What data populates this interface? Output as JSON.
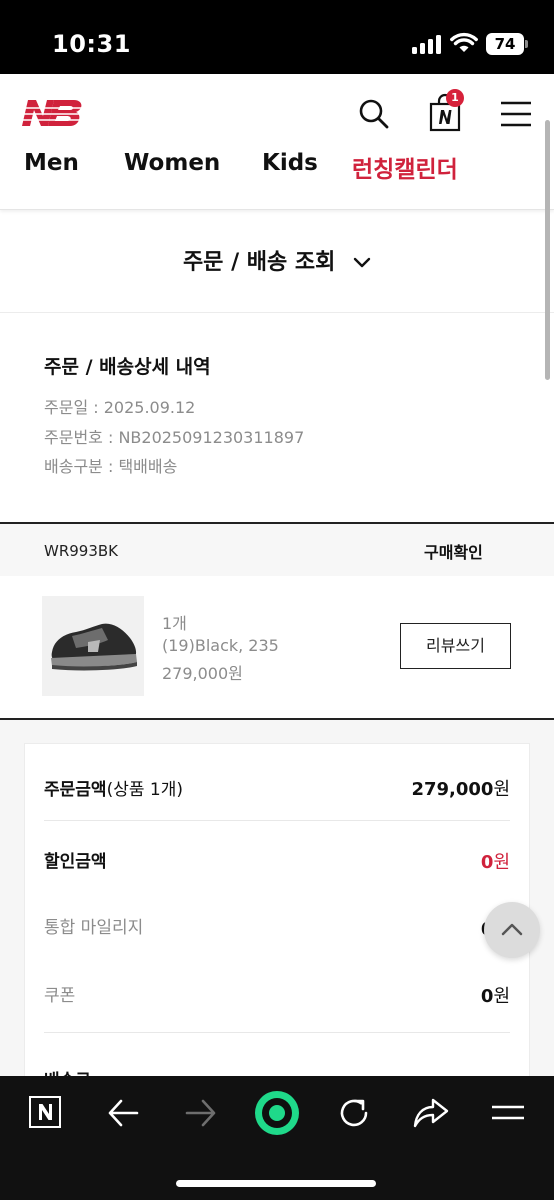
{
  "status": {
    "time": "10:31",
    "battery": "74"
  },
  "header": {
    "cart_count": "1",
    "nav": [
      "Men",
      "Women",
      "Kids",
      "런칭캘린더"
    ]
  },
  "page": {
    "title": "주문 / 배송 조회"
  },
  "detail": {
    "title": "주문 / 배송상세 내역",
    "order_date": "주문일 : 2025.09.12",
    "order_number": "주문번호 : NB2025091230311897",
    "delivery_type": "배송구분 : 택배배송"
  },
  "item": {
    "code": "WR993BK",
    "status": "구매확인",
    "qty": "1개",
    "option": "(19)Black, 235",
    "price": "279,000원",
    "review_label": "리뷰쓰기"
  },
  "summary": {
    "order_amount_label": "주문금액",
    "order_amount_sub": "(상품 1개)",
    "order_amount_value": "279,000",
    "discount_label": "할인금액",
    "discount_value": "0",
    "mileage_label": "통합 마일리지",
    "mileage_value": "0",
    "coupon_label": "쿠폰",
    "coupon_value": "0",
    "won": "원",
    "shipping_label": "배송료"
  },
  "colors": {
    "brand_red": "#d0223c",
    "badge_red": "#d6213a",
    "browser_green": "#1fd98a"
  },
  "icons": [
    "nb-logo-icon",
    "search-icon",
    "shopping-bag-icon",
    "menu-icon",
    "chevron-down-icon",
    "chevron-up-icon",
    "naver-n-icon",
    "back-arrow-icon",
    "forward-arrow-icon",
    "green-dot-icon",
    "reload-icon",
    "share-icon",
    "hamburger-icon"
  ]
}
